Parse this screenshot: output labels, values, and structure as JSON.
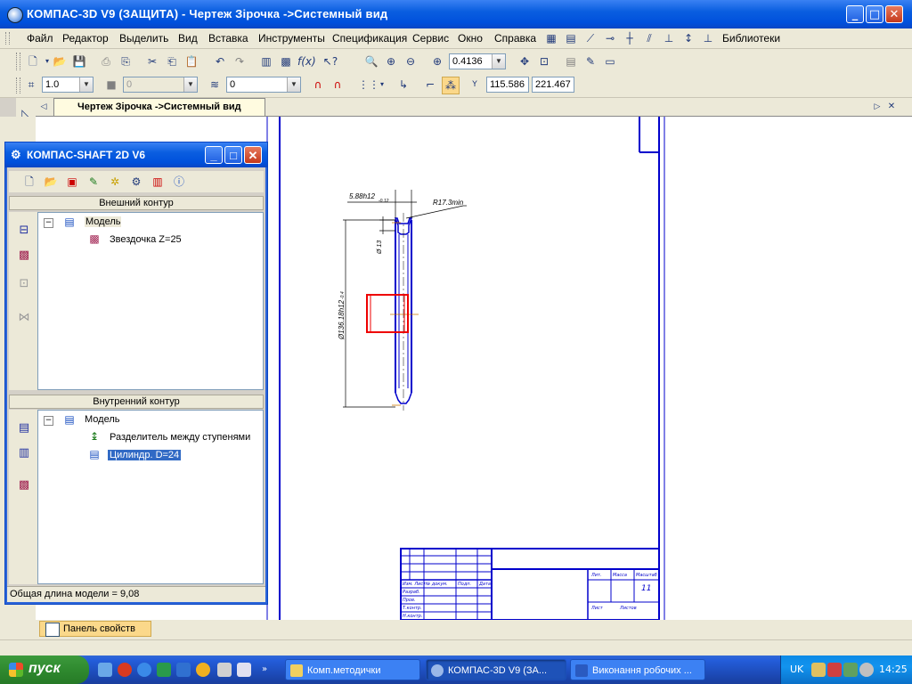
{
  "window": {
    "title": "КОМПАС-3D V9 (ЗАЩИТА) - Чертеж Зірочка ->Системный вид",
    "min": "_",
    "max": "□",
    "close": "✕"
  },
  "menu": [
    "Файл",
    "Редактор",
    "Выделить",
    "Вид",
    "Вставка",
    "Инструменты",
    "Спецификация",
    "Сервис",
    "Окно",
    "Справка"
  ],
  "menu_right": "Библиотеки",
  "toolbar": {
    "zoom": "0.4136",
    "line_scale": "1.0",
    "layer_disabled": "0",
    "layer": "0",
    "coord_x": "115.586",
    "coord_y": "221.467",
    "y_label": "Y"
  },
  "doc_tab": {
    "label": "Чертеж Зірочка ->Системный вид",
    "scroll_left": "◁",
    "scroll_right": "▷",
    "close": "✕"
  },
  "shaft_window": {
    "title": "КОМПАС-SHAFT 2D V6",
    "outer_header": "Внешний контур",
    "outer_tree": {
      "root": "Модель",
      "child": "Звездочка Z=25"
    },
    "inner_header": "Внутренний контур",
    "inner_tree": {
      "root": "Модель",
      "child1": "Разделитель между ступенями",
      "child2": "Цилиндр. D=24"
    },
    "status": "Общая длина модели = 9,08",
    "min": "_",
    "max": "□",
    "close": "✕"
  },
  "drawing": {
    "dim_top": "5.88h12",
    "dim_top_sub": "-0.12",
    "dim_radius": "R17.3min",
    "dim_small": "Ø 13",
    "dim_diameter": "Ø136.18h12",
    "dim_diameter_sub": "-0.4",
    "stamp_sheet": "11",
    "stamp_lit": "Лит.",
    "stamp_mass": "Масса",
    "stamp_scale": "Масштаб",
    "stamp_sheet_label": "Лист",
    "stamp_sheets_label": "Листов",
    "stamp_rows": [
      "Изм. Лист",
      "№ докум.",
      "Подп.",
      "Дата",
      "Разраб.",
      "Пров.",
      "Т.контр.",
      "Н.контр."
    ]
  },
  "status_panel": "Панель свойств",
  "taskbar": {
    "start": "пуск",
    "tasks": [
      "Комп.методички",
      "КОМПАС-3D V9 (ЗА...",
      "Виконання робочих ..."
    ],
    "lang": "UK",
    "time": "14:25"
  },
  "colors": {
    "titlebar": "#0a5ee0",
    "drawing_line": "#0000cc",
    "highlight": "#ee0000",
    "taskbar": "#245edb",
    "start": "#2f8a2f"
  }
}
